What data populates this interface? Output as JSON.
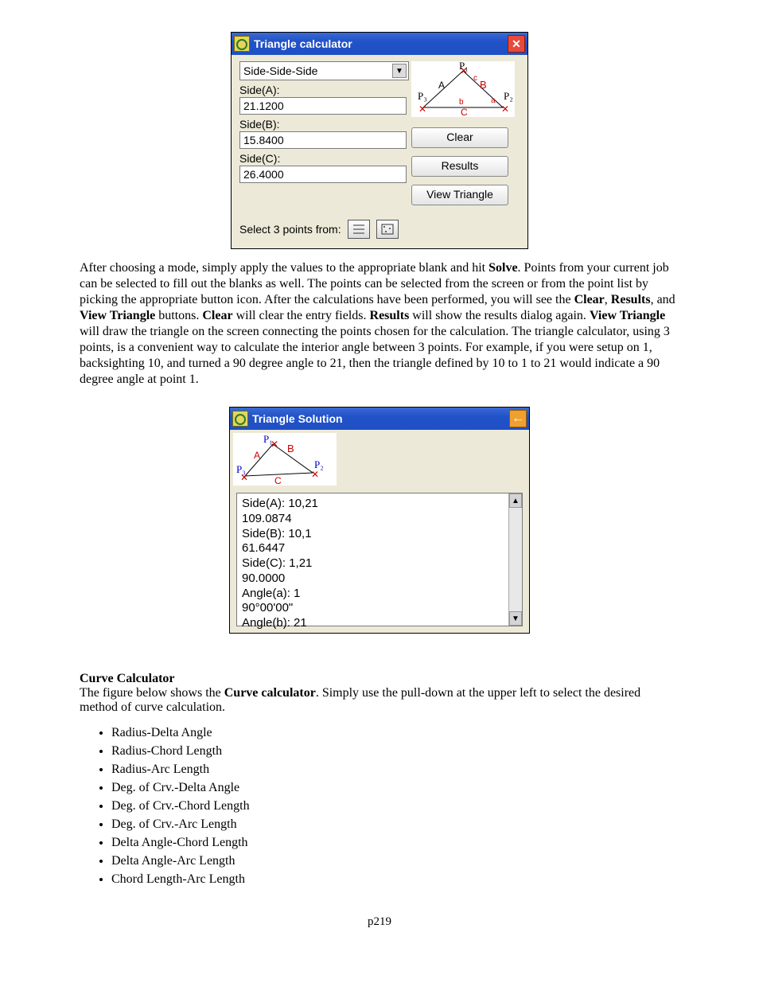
{
  "dlg1": {
    "title": "Triangle calculator",
    "mode": "Side-Side-Side",
    "sideA_label": "Side(A):",
    "sideA_value": "21.1200",
    "sideB_label": "Side(B):",
    "sideB_value": "15.8400",
    "sideC_label": "Side(C):",
    "sideC_value": "26.4000",
    "btn_clear": "Clear",
    "btn_results": "Results",
    "btn_view": "View Triangle",
    "select_label": "Select 3 points from:",
    "diagram_labels": {
      "A": "A",
      "B": "B",
      "C": "C",
      "P1": "P₁",
      "P2": "P₂",
      "P3": "P₃",
      "a": "a",
      "b": "b",
      "c": "c"
    }
  },
  "para1": {
    "t1": "After choosing a mode, simply apply the values to the appropriate blank and hit ",
    "b1": "Solve",
    "t2": ". Points from your current job can be selected to fill out the blanks as well. The points can be selected from the screen or from the point list by picking the appropriate button icon. After the calculations have been performed, you will see the ",
    "b2": "Clear",
    "c1": ", ",
    "b3": "Results",
    "c2": ", and ",
    "b4": "View Triangle",
    "t3": " buttons. ",
    "b5": "Clear",
    "t4": " will clear the entry fields. ",
    "b6": "Results",
    "t5": " will show the results dialog again.  ",
    "b7": "View Triangle",
    "t6": " will draw the triangle on the screen connecting the points chosen for the calculation.  The triangle calculator, using 3 points, is a convenient way to calculate the interior angle between 3 points.  For example, if you were setup on 1, backsighting 10, and turned a 90 degree angle to 21, then the triangle defined by 10 to 1 to 21 would indicate a 90 degree angle at point 1."
  },
  "dlg2": {
    "title": "Triangle Solution",
    "results": [
      "Side(A): 10,21",
      "109.0874",
      "Side(B): 10,1",
      "61.6447",
      "Side(C): 1,21",
      "90.0000",
      "Angle(a): 1",
      "90°00'00\"",
      "Angle(b): 21"
    ]
  },
  "curve": {
    "heading": "Curve Calculator",
    "lead1": "The figure below shows the ",
    "bold": "Curve calculator",
    "lead2": ". Simply use the pull-down at the upper left to select the desired method of curve calculation.",
    "items": [
      "Radius-Delta Angle",
      "Radius-Chord Length",
      "Radius-Arc Length",
      "Deg. of Crv.-Delta Angle",
      "Deg. of Crv.-Chord Length",
      "Deg. of Crv.-Arc Length",
      "Delta Angle-Chord Length",
      "Delta Angle-Arc Length",
      "Chord Length-Arc Length"
    ]
  },
  "pagenum": "p219"
}
